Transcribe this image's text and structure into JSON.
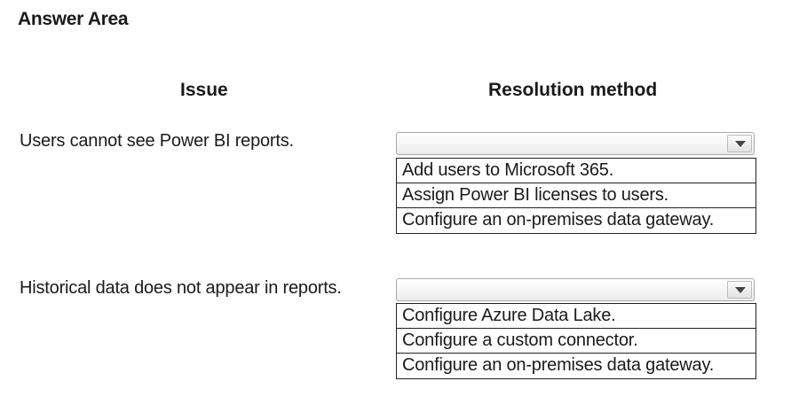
{
  "title": "Answer Area",
  "headers": {
    "issue": "Issue",
    "resolution": "Resolution method"
  },
  "rows": [
    {
      "issue": "Users cannot see Power BI reports.",
      "selected": "",
      "options": [
        "Add users to Microsoft 365.",
        "Assign Power BI licenses to users.",
        "Configure an on-premises data gateway."
      ]
    },
    {
      "issue": "Historical data does not appear in reports.",
      "selected": "",
      "options": [
        "Configure Azure Data Lake.",
        "Configure a custom connector.",
        "Configure an on-premises data gateway."
      ]
    }
  ],
  "icons": {
    "dropdown": "chevron-down-icon"
  }
}
